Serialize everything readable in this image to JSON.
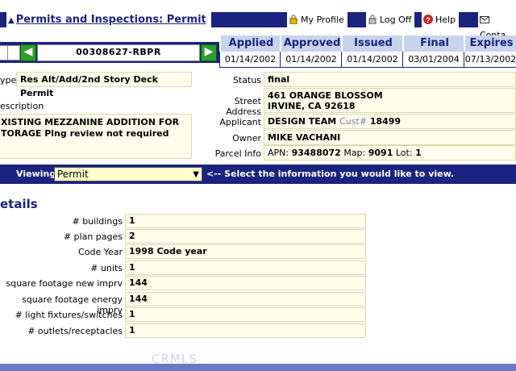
{
  "header": {
    "breadcrumb": "Permits and Inspections: Permit",
    "links": [
      {
        "label": "My Profile",
        "icon": "lock-icon"
      },
      {
        "label": "Log Off",
        "icon": "padlock-icon"
      },
      {
        "label": "Help",
        "icon": "help-icon"
      },
      {
        "label": "Conta",
        "icon": "envelope-icon"
      }
    ]
  },
  "permit": {
    "number": "00308627-RBPR",
    "status_columns": [
      {
        "label": "Applied",
        "date": "01/14/2002"
      },
      {
        "label": "Approved",
        "date": "01/14/2002"
      },
      {
        "label": "Issued",
        "date": "01/14/2002"
      },
      {
        "label": "Final",
        "date": "03/01/2004"
      },
      {
        "label": "Expires",
        "date": "07/13/2002"
      }
    ],
    "type_label": "ype",
    "type_value": "Res Alt/Add/2nd Story Deck Permit",
    "description_label": "escription",
    "description_value": "XISTING MEZZANINE ADDITION FOR TORAGE Plng review not required",
    "status_label": "Status",
    "status_value": "final",
    "address_label": "Street Address",
    "address_line1": "461 ORANGE BLOSSOM",
    "address_line2": "IRVINE, CA 92618",
    "applicant_label": "Applicant",
    "applicant_value": "DESIGN TEAM",
    "cust_label": "Cust#",
    "cust_value": "18499",
    "owner_label": "Owner",
    "owner_value": "MIKE VACHANI",
    "parcel_label": "Parcel Info",
    "apn_label": "APN:",
    "apn_value": "93488072",
    "map_label": "Map:",
    "map_value": "9091",
    "lot_label": "Lot:",
    "lot_value": "1"
  },
  "viewing": {
    "label": "Viewing",
    "selected": "Permit",
    "hint": "<-- Select the information you would like to view."
  },
  "details": {
    "title": "etails",
    "rows": [
      {
        "label": "# buildings",
        "value": "1"
      },
      {
        "label": "# plan pages",
        "value": "2"
      },
      {
        "label": "Code Year",
        "value": "1998 Code year"
      },
      {
        "label": "# units",
        "value": "1"
      },
      {
        "label": "square footage new imprv",
        "value": "144"
      },
      {
        "label": "square footage energy imprv",
        "value": "144"
      },
      {
        "label": "# light fixtures/switches",
        "value": "1"
      },
      {
        "label": "# outlets/receptacles",
        "value": "1"
      }
    ]
  },
  "watermark": "CRMLS",
  "colors": {
    "navy": "#1a237e",
    "header_cell": "#c8d3ec",
    "field_bg": "#fdfdea",
    "select_bg": "#ffffcc",
    "arrow_green": "#2e9e2e"
  }
}
